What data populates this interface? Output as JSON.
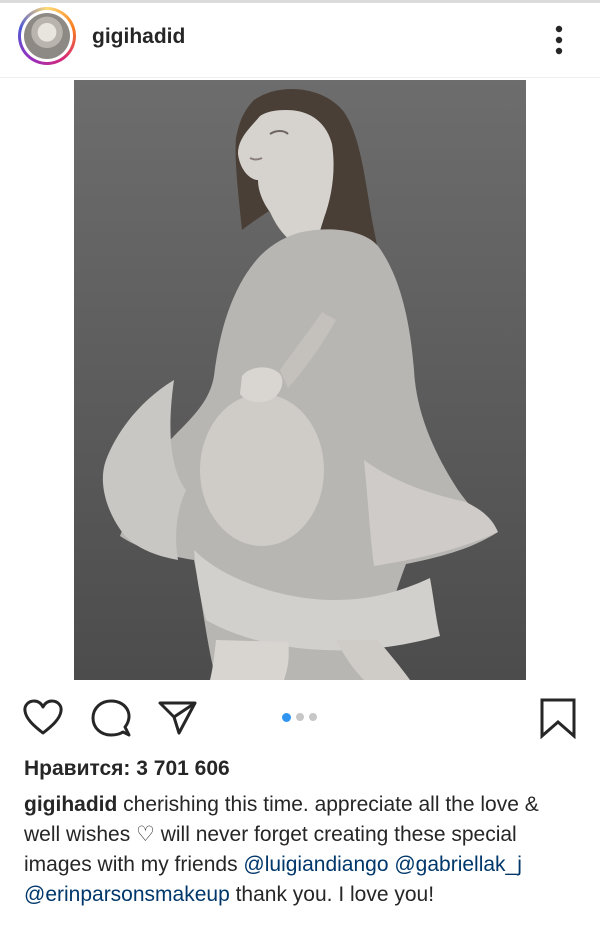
{
  "post": {
    "username": "gigihadid",
    "likes_text": "Нравится: 3 701 606",
    "caption": {
      "username": "gigihadid",
      "text_1": " cherishing this time. appreciate all the love & well wishes ♡ will never forget creating these special images with my friends ",
      "mention_1": "@luigiandiango",
      "mention_2": "@gabriellak_j",
      "mention_3": "@erinparsonsmakeup",
      "text_2": " thank you. I love you!"
    },
    "carousel": {
      "total": 3,
      "active_index": 0
    }
  },
  "icons": {
    "more": "more-options-icon",
    "like": "heart-icon",
    "comment": "comment-icon",
    "share": "share-icon",
    "save": "bookmark-icon"
  },
  "colors": {
    "text": "#262626",
    "mention": "#00376b",
    "carousel_active": "#2f95f1",
    "carousel_inactive": "#c7c7c7"
  }
}
